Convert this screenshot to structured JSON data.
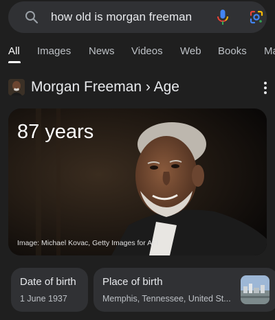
{
  "search": {
    "query": "how old is morgan freeman",
    "icons": {
      "search": "search-icon",
      "mic": "mic-icon",
      "lens": "google-lens-icon"
    },
    "colors": {
      "mic_blue": "#4285f4",
      "mic_red": "#ea4335",
      "mic_yellow": "#fbbc05",
      "mic_green": "#34a853"
    }
  },
  "tabs": [
    {
      "label": "All",
      "active": true
    },
    {
      "label": "Images"
    },
    {
      "label": "News"
    },
    {
      "label": "Videos"
    },
    {
      "label": "Web"
    },
    {
      "label": "Books"
    },
    {
      "label": "Ma"
    }
  ],
  "entity": {
    "title": "Morgan Freeman › Age",
    "more_icon": "more-vert-icon"
  },
  "answer": {
    "value": "87 years",
    "image_credit": "Image: Michael Kovac, Getty Images for AFI"
  },
  "facts": [
    {
      "label": "Date of birth",
      "value": "1 June 1937"
    },
    {
      "label": "Place of birth",
      "value": "Memphis, Tennessee, United St..."
    }
  ]
}
